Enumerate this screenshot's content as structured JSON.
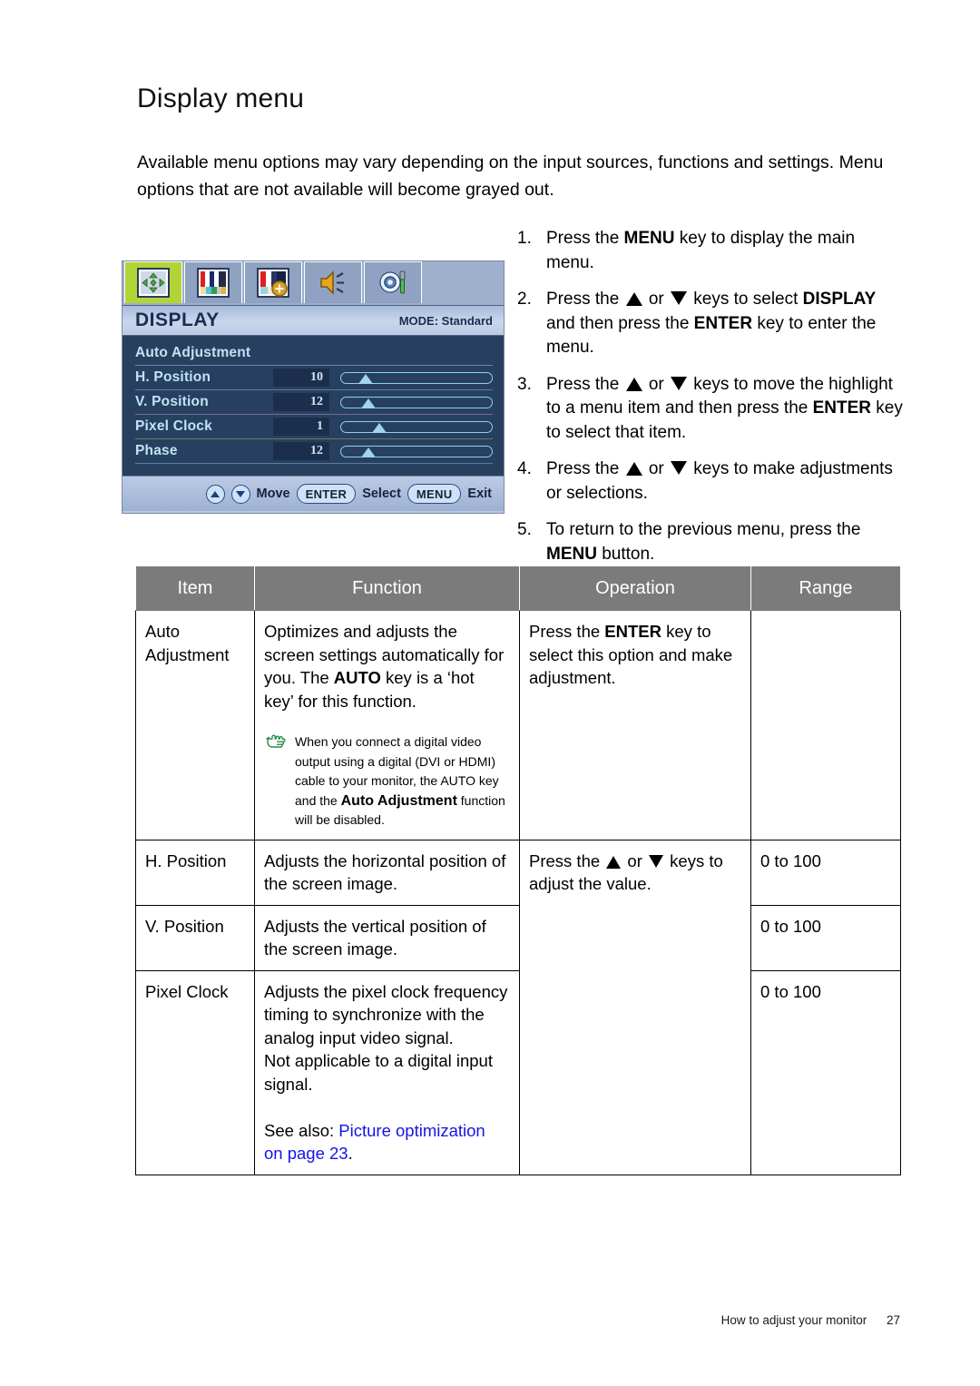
{
  "page": {
    "title": "Display menu",
    "intro": "Available menu options may vary depending on the input sources, functions and settings. Menu options that are not available will become grayed out.",
    "footer_text": "How to adjust your monitor",
    "footer_page": "27"
  },
  "osd": {
    "tabs": [
      {
        "name": "display-tab",
        "icon": "display-move-icon",
        "active": true
      },
      {
        "name": "picture-tab",
        "icon": "color-bars-icon",
        "active": false
      },
      {
        "name": "picture-advanced-tab",
        "icon": "color-bars-plus-icon",
        "active": false
      },
      {
        "name": "audio-tab",
        "icon": "speaker-icon",
        "active": false
      },
      {
        "name": "system-tab",
        "icon": "gear-screwdriver-icon",
        "active": false
      }
    ],
    "title": "DISPLAY",
    "mode_label": "MODE: Standard",
    "items": [
      {
        "label": "Auto Adjustment",
        "value": "",
        "has_slider": false,
        "percent": 0
      },
      {
        "label": "H. Position",
        "value": "10",
        "has_slider": true,
        "percent": 10
      },
      {
        "label": "V. Position",
        "value": "12",
        "has_slider": true,
        "percent": 12
      },
      {
        "label": "Pixel Clock",
        "value": "1",
        "has_slider": true,
        "percent": 24
      },
      {
        "label": "Phase",
        "value": "12",
        "has_slider": true,
        "percent": 12
      }
    ],
    "footer": {
      "move_label": "Move",
      "enter_key": "ENTER",
      "select_label": "Select",
      "menu_key": "MENU",
      "exit_label": "Exit"
    }
  },
  "steps": [
    {
      "num": "1.",
      "parts": [
        {
          "t": "Press the "
        },
        {
          "t": "MENU",
          "b": true
        },
        {
          "t": " key to display the main menu."
        }
      ]
    },
    {
      "num": "2.",
      "parts": [
        {
          "t": "Press the "
        },
        {
          "icon": "triangle-up"
        },
        {
          "t": " or "
        },
        {
          "icon": "triangle-down"
        },
        {
          "t": " keys to select "
        },
        {
          "t": "DISPLAY",
          "b": true
        },
        {
          "t": " and then press the "
        },
        {
          "t": "ENTER",
          "b": true
        },
        {
          "t": " key to enter the menu."
        }
      ]
    },
    {
      "num": "3.",
      "parts": [
        {
          "t": "Press the "
        },
        {
          "icon": "triangle-up"
        },
        {
          "t": " or "
        },
        {
          "icon": "triangle-down"
        },
        {
          "t": " keys to move the highlight to a menu item and then press the "
        },
        {
          "t": "ENTER",
          "b": true
        },
        {
          "t": " key to select that item."
        }
      ]
    },
    {
      "num": "4.",
      "parts": [
        {
          "t": "Press the "
        },
        {
          "icon": "triangle-up"
        },
        {
          "t": " or "
        },
        {
          "icon": "triangle-down"
        },
        {
          "t": " keys to make adjustments or selections."
        }
      ]
    },
    {
      "num": "5.",
      "parts": [
        {
          "t": "To return to the previous menu, press the "
        },
        {
          "t": "MENU",
          "b": true
        },
        {
          "t": " button."
        }
      ]
    }
  ],
  "table": {
    "headers": [
      "Item",
      "Function",
      "Operation",
      "Range"
    ],
    "rows": [
      {
        "item": "Auto Adjustment",
        "function_parts": [
          {
            "t": "Optimizes and adjusts the screen settings automatically for you. The "
          },
          {
            "t": "AUTO",
            "b": true
          },
          {
            "t": " key is a ‘hot key’ for this function."
          }
        ],
        "note": {
          "icon": "pointing-hand-icon",
          "parts": [
            {
              "t": "When you connect a digital video output using a digital (DVI or HDMI) cable to your monitor, the AUTO key and the "
            },
            {
              "t": "Auto Adjustment",
              "big": true
            },
            {
              "t": " function will be disabled."
            }
          ]
        },
        "operation_parts": [
          {
            "t": "Press the "
          },
          {
            "t": "ENTER",
            "b": true
          },
          {
            "t": " key to select this option and make adjustment."
          }
        ],
        "range": ""
      },
      {
        "item": "H. Position",
        "function_parts": [
          {
            "t": "Adjusts the horizontal position of the screen image."
          }
        ],
        "operation_parts": [
          {
            "t": "Press the "
          },
          {
            "icon": "triangle-up"
          },
          {
            "t": " or "
          },
          {
            "icon": "triangle-down"
          },
          {
            "t": " keys to adjust the value."
          }
        ],
        "operation_rowspan": 3,
        "range": "0 to 100"
      },
      {
        "item": "V. Position",
        "function_parts": [
          {
            "t": "Adjusts the vertical position of the screen image."
          }
        ],
        "range": "0 to 100"
      },
      {
        "item": "Pixel Clock",
        "function_parts": [
          {
            "t": "Adjusts the pixel clock frequency timing to synchronize with the analog input video signal."
          },
          {
            "br": true
          },
          {
            "t": "Not applicable to a digital input signal."
          },
          {
            "br": true
          },
          {
            "br": true
          },
          {
            "t": "See also: "
          },
          {
            "t": "Picture optimization on page 23",
            "link": true
          },
          {
            "t": "."
          }
        ],
        "range": "0 to 100"
      }
    ]
  },
  "colors": {
    "link": "#1414e6",
    "table_header_bg": "#7b7b7b",
    "osd_accent_green": "#b3d436",
    "osd_body_bg": "#27405f",
    "note_icon": "#2a8a52"
  }
}
